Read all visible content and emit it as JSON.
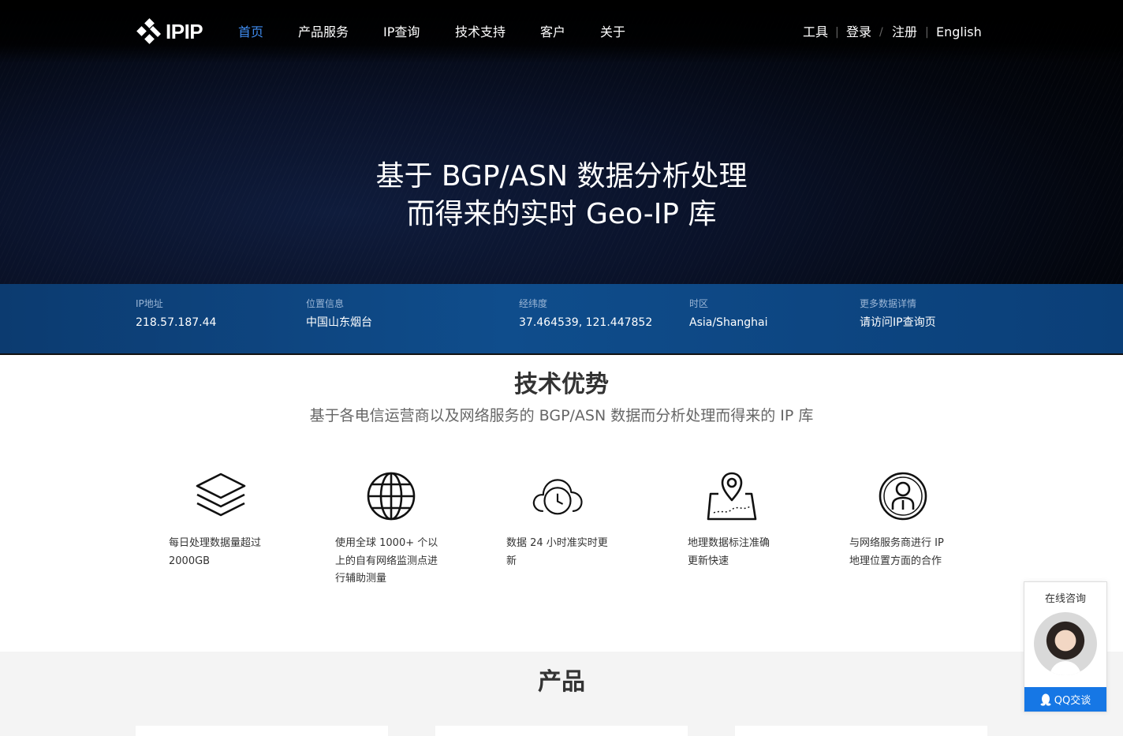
{
  "brand": {
    "name": "IPIP"
  },
  "nav": [
    {
      "label": "首页",
      "active": true
    },
    {
      "label": "产品服务",
      "active": false
    },
    {
      "label": "IP查询",
      "active": false
    },
    {
      "label": "技术支持",
      "active": false
    },
    {
      "label": "客户",
      "active": false
    },
    {
      "label": "关于",
      "active": false
    }
  ],
  "header_links": {
    "tools": "工具",
    "login": "登录",
    "register": "注册",
    "language": "English",
    "sep_bar": "|",
    "sep_slash": "/"
  },
  "hero": {
    "line1": "基于 BGP/ASN 数据分析处理",
    "line2": "而得来的实时 Geo-IP 库"
  },
  "ip_info": [
    {
      "label": "IP地址",
      "value": "218.57.187.44"
    },
    {
      "label": "位置信息",
      "value": "中国山东烟台"
    },
    {
      "label": "经纬度",
      "value": "37.464539, 121.447852"
    },
    {
      "label": "时区",
      "value": "Asia/Shanghai"
    },
    {
      "label": "更多数据详情",
      "value": "请访问IP查询页"
    }
  ],
  "advantages": {
    "title": "技术优势",
    "subtitle": "基于各电信运营商以及网络服务的 BGP/ASN 数据而分析处理而得来的 IP 库",
    "items": [
      {
        "icon": "layers-icon",
        "lines": [
          "每日处理数据量超过",
          "2000GB"
        ]
      },
      {
        "icon": "globe-icon",
        "lines": [
          "使用全球 1000+ 个以",
          "上的自有网络监测点进",
          "行辅助测量"
        ]
      },
      {
        "icon": "cloud-clock-icon",
        "lines": [
          "数据 24 小时准实时更",
          "新"
        ]
      },
      {
        "icon": "map-pin-icon",
        "lines": [
          "地理数据标注准确",
          "更新快速"
        ]
      },
      {
        "icon": "user-circle-icon",
        "lines": [
          "与网络服务商进行 IP",
          "地理位置方面的合作"
        ]
      }
    ]
  },
  "products": {
    "title": "产品"
  },
  "consult": {
    "title": "在线咨询",
    "button": "QQ交谈"
  },
  "colors": {
    "active_nav": "#3f8cf0",
    "info_strip": "#0f4d8c",
    "qq_button": "#1677e5"
  }
}
